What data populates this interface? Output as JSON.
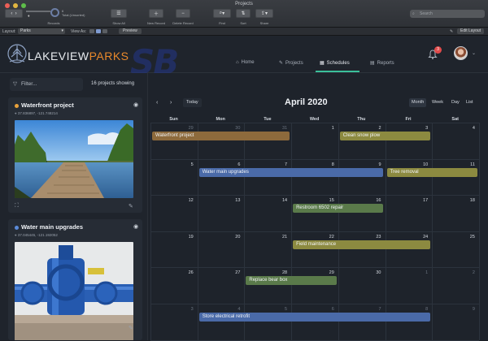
{
  "window": {
    "title": "Projects"
  },
  "toolbar": {
    "records_label": "Records",
    "records_count": "6",
    "records_status": "Total (Unsorted)",
    "show_all_label": "Show All",
    "new_record_label": "New Record",
    "delete_record_label": "Delete Record",
    "find_label": "Find",
    "sort_label": "Sort",
    "share_label": "Share",
    "search_placeholder": "Search"
  },
  "layoutbar": {
    "layout_label": "Layout:",
    "layout_value": "Parks",
    "view_as_label": "View As:",
    "preview_label": "Preview",
    "edit_layout_label": "Edit Layout"
  },
  "app": {
    "brand_primary": "LAKEVIEW",
    "brand_accent": "PARKS",
    "watermark": "SB",
    "nav": [
      {
        "label": "Home",
        "icon": "home-icon"
      },
      {
        "label": "Projects",
        "icon": "wrench-icon"
      },
      {
        "label": "Schedules",
        "icon": "calendar-icon",
        "active": true
      },
      {
        "label": "Reports",
        "icon": "document-icon"
      }
    ],
    "notification_count": "3",
    "accent_color": "#3bbf9a",
    "brand_color": "#e9892b"
  },
  "sidebar": {
    "filter_placeholder": "Filter...",
    "project_count_text": "16 projects showing",
    "cards": [
      {
        "title": "Waterfront project",
        "coords": "37.836897, -121.748214",
        "dot_color": "#e9a23b"
      },
      {
        "title": "Water main upgrades",
        "coords": "37.045445, -121.192052",
        "dot_color": "#5b8bd9"
      }
    ]
  },
  "calendar": {
    "today_label": "Today",
    "month_title": "April 2020",
    "views": [
      "Month",
      "Week",
      "Day",
      "List"
    ],
    "active_view": "Month",
    "weekdays": [
      "Sun",
      "Mon",
      "Tue",
      "Wed",
      "Thu",
      "Fri",
      "Sat"
    ],
    "weeks": [
      [
        "29",
        "30",
        "31",
        "1",
        "2",
        "3",
        "4"
      ],
      [
        "5",
        "6",
        "7",
        "8",
        "9",
        "10",
        "11"
      ],
      [
        "12",
        "13",
        "14",
        "15",
        "16",
        "17",
        "18"
      ],
      [
        "19",
        "20",
        "21",
        "22",
        "23",
        "24",
        "25"
      ],
      [
        "26",
        "27",
        "28",
        "29",
        "30",
        "1",
        "2"
      ],
      [
        "3",
        "4",
        "5",
        "6",
        "7",
        "8",
        "9"
      ]
    ],
    "events": [
      {
        "label": "Waterfront project",
        "color": "orange"
      },
      {
        "label": "Clean snow plow",
        "color": "yellow"
      },
      {
        "label": "Water main upgrades",
        "color": "blue"
      },
      {
        "label": "Tree removal",
        "color": "yellow"
      },
      {
        "label": "Restroom 6502 repair",
        "color": "green"
      },
      {
        "label": "Field maintenance",
        "color": "yellow"
      },
      {
        "label": "Replace bear box",
        "color": "green"
      },
      {
        "label": "Store electrical retrofit",
        "color": "blue"
      }
    ]
  }
}
